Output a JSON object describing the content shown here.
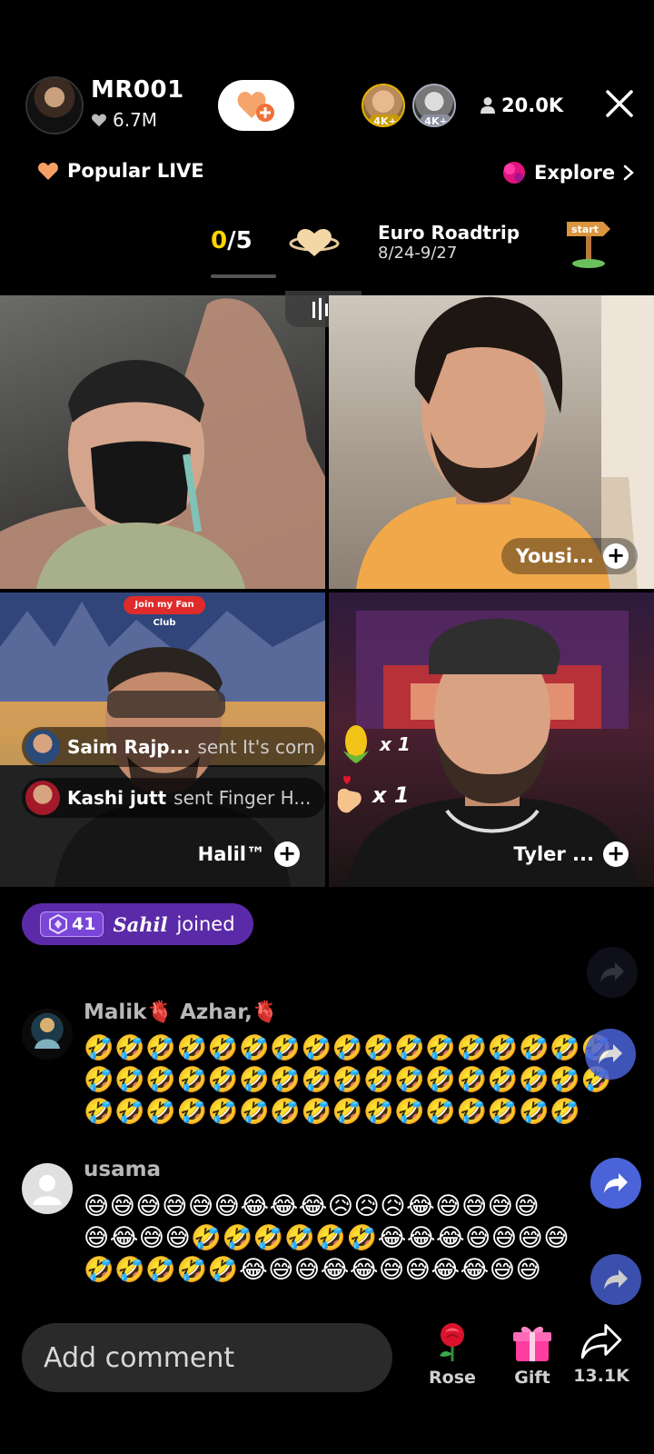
{
  "host": {
    "name": "MR001",
    "likes": "6.7M"
  },
  "top_viewers": [
    {
      "badge": "4K+"
    },
    {
      "badge": "4K+"
    }
  ],
  "viewer_count": "20.0K",
  "popular_live": "Popular LIVE",
  "explore": "Explore",
  "event": {
    "progress_current": "0",
    "progress_total": "/5",
    "title": "Euro Roadtrip",
    "dates": "8/24-9/27",
    "sign_text": "start"
  },
  "guests": {
    "top_right": "Yousi...",
    "bottom_left": "Halil™",
    "bottom_right": "Tyler ..."
  },
  "fan_club": "Join my Fan Club",
  "gift_messages": [
    {
      "name": "Saim Rajp...",
      "text": "sent It's corn"
    },
    {
      "name": "Kashi jutt",
      "text": "sent Finger H..."
    }
  ],
  "gift_counts": [
    {
      "count": "x 1"
    },
    {
      "count": "x 1"
    }
  ],
  "join_event": {
    "level": "41",
    "user": "Sahil",
    "text": "joined"
  },
  "comments": [
    {
      "name": "Malik🫀 Azhar,🫀",
      "lines": [
        "🤣🤣🤣🤣🤣🤣🤣🤣🤣🤣🤣🤣🤣🤣🤣🤣🤣",
        "🤣🤣🤣🤣🤣🤣🤣🤣🤣🤣🤣🤣🤣🤣🤣🤣🤣",
        "🤣🤣🤣🤣🤣🤣🤣🤣🤣🤣🤣🤣🤣🤣🤣🤣"
      ]
    },
    {
      "name": "usama",
      "lines": [
        "😅😅😅😅😅😅😂😂😂😥😥😥😂😅😅😅😅",
        "😅😂😅😅🤣🤣🤣🤣🤣🤣😂😂😂😅😅😅😅",
        "🤣🤣🤣🤣🤣😂😅😅😂😂😅😅😂😂😅😅"
      ]
    }
  ],
  "bottom_bar": {
    "placeholder": "Add comment",
    "rose": "Rose",
    "gift": "Gift",
    "share_count": "13.1K"
  },
  "colors": {
    "accent_yellow": "#ffd400",
    "join_purple": "#5b2aa8",
    "share_blue": "#4a63d8"
  }
}
